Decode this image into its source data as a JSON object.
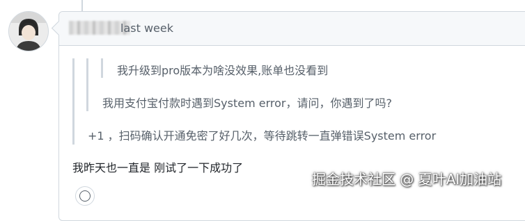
{
  "comment": {
    "timestamp": "last week",
    "quotes": [
      "我升级到pro版本为啥没效果,账单也没看到",
      "我用支付宝付款时遇到System error，请问，你遇到了吗?",
      "+1 ，扫码确认开通免密了好几次，等待跳转一直弹错误System error"
    ],
    "reply": "我昨天也一直是 刚试了一下成功了"
  },
  "icons": {
    "avatar": "avatar-image",
    "reaction": "smiley-icon"
  },
  "watermark": "掘金技术社区 @ 夏叶AI加油站",
  "colors": {
    "border": "#d0d7de",
    "header_bg": "#f6f8fa",
    "muted_text": "#57606a",
    "text": "#1f2328"
  }
}
